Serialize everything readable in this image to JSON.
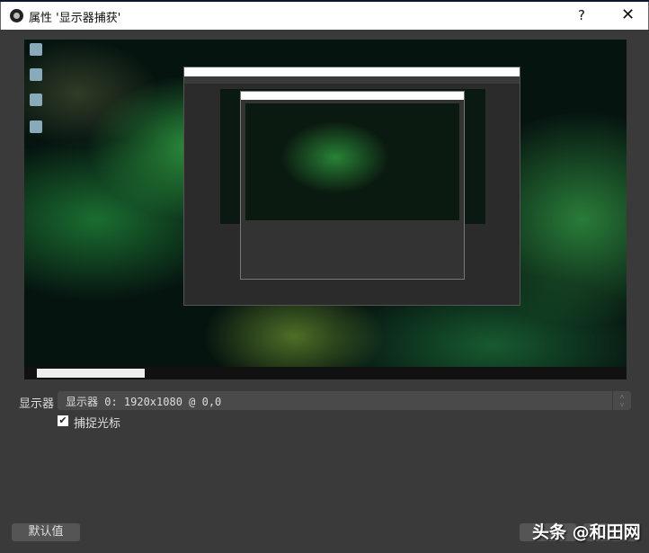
{
  "dialog": {
    "title": "属性 '显示器捕获'",
    "help": "?",
    "close": "✕"
  },
  "form": {
    "display_label": "显示器",
    "display_value": "显示器 0: 1920x1080 @ 0,0",
    "capture_cursor_label": "捕捉光标",
    "capture_cursor_checked": true
  },
  "buttons": {
    "defaults": "默认值"
  },
  "watermark": "头条 @和田网"
}
